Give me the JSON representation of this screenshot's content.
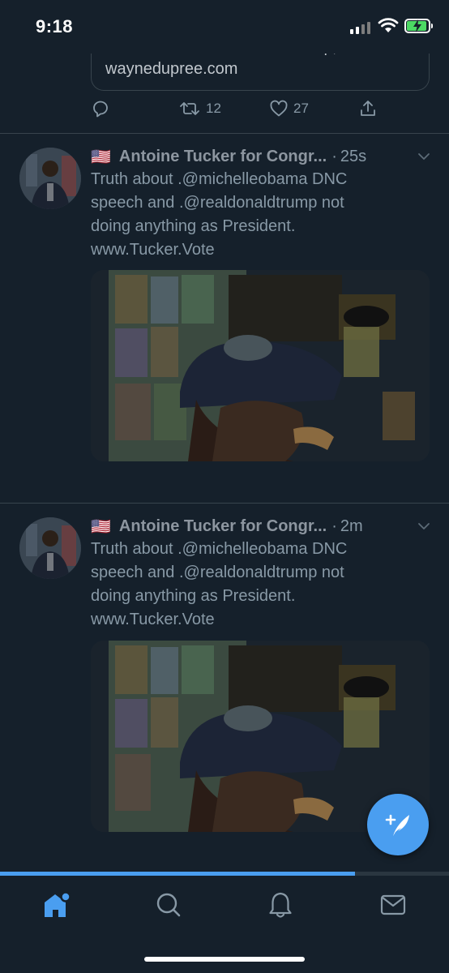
{
  "status_bar": {
    "time": "9:18",
    "battery_charging": true
  },
  "link_card": {
    "cut_title": "Anarchists With Bear Mace \"Help,...",
    "domain": "waynedupree.com"
  },
  "prev_tweet_actions": {
    "retweets": "12",
    "likes": "27"
  },
  "tweets": [
    {
      "flag": "🇺🇸",
      "author": "Antoine Tucker for Congr...",
      "time_ago": "25s",
      "text_lines": [
        "Truth about .@michelleobama DNC",
        "speech and .@realdonaldtrump not",
        "doing anything as President.",
        "www.Tucker.Vote"
      ]
    },
    {
      "flag": "🇺🇸",
      "author": "Antoine Tucker for Congr...",
      "time_ago": "2m",
      "text_lines": [
        "Truth about .@michelleobama DNC",
        "speech and .@realdonaldtrump not",
        "doing anything as President.",
        "www.Tucker.Vote"
      ]
    }
  ],
  "video_progress": 0.79,
  "tabs": [
    "home",
    "search",
    "notifications",
    "messages"
  ],
  "colors": {
    "background": "#15202b",
    "accent": "#4a9ef0",
    "text_dim": "#8899a6",
    "divider": "#38444d"
  }
}
